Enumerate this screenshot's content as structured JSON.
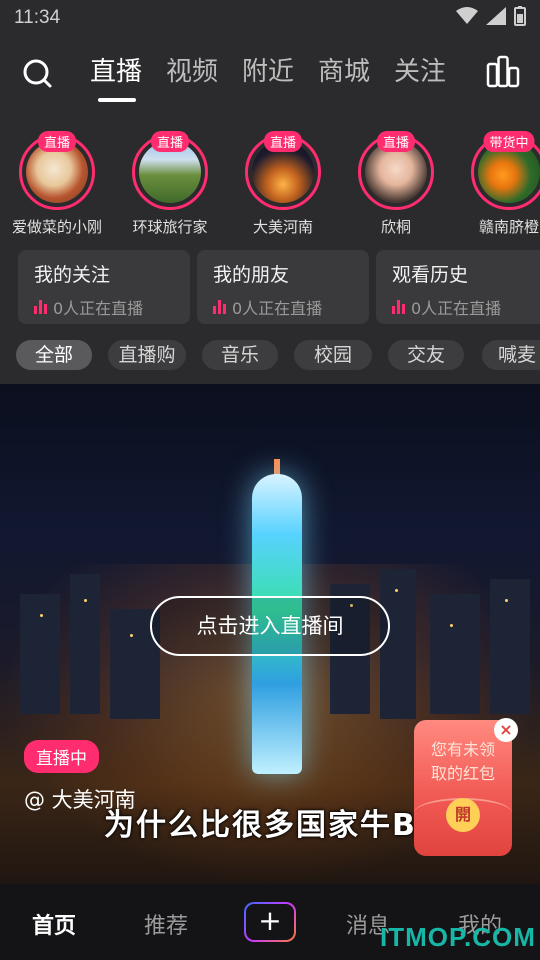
{
  "status_bar": {
    "time": "11:34"
  },
  "top_nav": {
    "tabs": [
      {
        "label": "直播",
        "active": true
      },
      {
        "label": "视频"
      },
      {
        "label": "附近"
      },
      {
        "label": "商城"
      },
      {
        "label": "关注"
      }
    ]
  },
  "stories": [
    {
      "badge": "直播",
      "name": "爱做菜的小刚"
    },
    {
      "badge": "直播",
      "name": "环球旅行家"
    },
    {
      "badge": "直播",
      "name": "大美河南"
    },
    {
      "badge": "直播",
      "name": "欣桐"
    },
    {
      "badge": "带货中",
      "name": "赣南脐橙"
    }
  ],
  "cards": [
    {
      "title": "我的关注",
      "sub": "0人正在直播"
    },
    {
      "title": "我的朋友",
      "sub": "0人正在直播"
    },
    {
      "title": "观看历史",
      "sub": "0人正在直播"
    }
  ],
  "chips": [
    "全部",
    "直播购",
    "音乐",
    "校园",
    "交友",
    "喊麦"
  ],
  "live": {
    "enter_label": "点击进入直播间",
    "badge": "直播中",
    "anchor": "@ 大美河南",
    "caption": "为什么比很多国家牛B"
  },
  "envelope": {
    "text": "您有未领取的红包",
    "open_label": "開",
    "close_label": "×"
  },
  "bottom_nav": {
    "home": "首页",
    "recommend": "推荐",
    "plus": "+",
    "messages": "消息",
    "me": "我的"
  },
  "watermark": "ITMOP.COM",
  "colors": {
    "accent": "#ff2d6f",
    "background": "#2b2b2d"
  }
}
